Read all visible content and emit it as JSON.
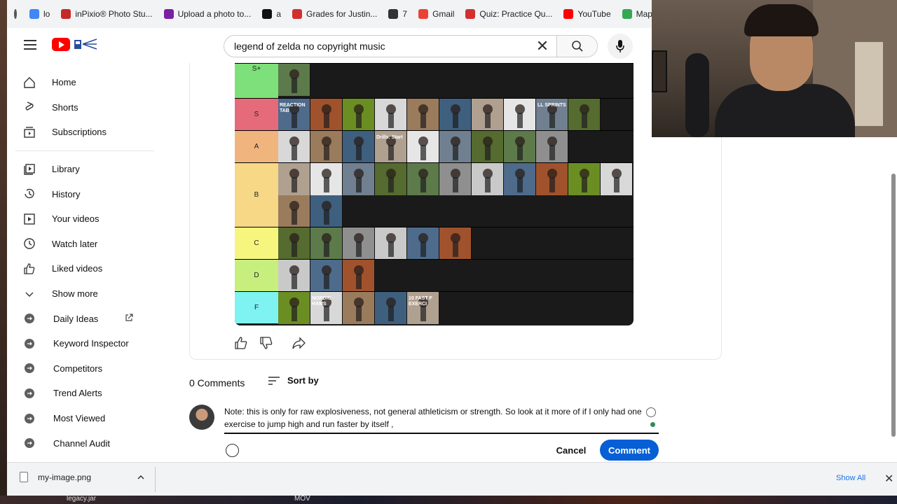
{
  "bookmarks": [
    {
      "label": "lo",
      "icon": "google-icon",
      "color": "#4285f4"
    },
    {
      "label": "inPixio® Photo Stu...",
      "icon": "bookmark-icon",
      "color": "#c62828"
    },
    {
      "label": "Upload a photo to...",
      "icon": "bookmark-icon",
      "color": "#7b1fa2"
    },
    {
      "label": "a",
      "icon": "gs-icon",
      "color": "#111111"
    },
    {
      "label": "Grades for Justin...",
      "icon": "canvas-icon",
      "color": "#d32f2f"
    },
    {
      "label": "7",
      "icon": "bookmark-icon",
      "color": "#333333"
    },
    {
      "label": "Gmail",
      "icon": "gmail-icon",
      "color": "#ea4335"
    },
    {
      "label": "Quiz: Practice Qu...",
      "icon": "canvas-icon",
      "color": "#d32f2f"
    },
    {
      "label": "YouTube",
      "icon": "youtube-icon",
      "color": "#ff0000"
    },
    {
      "label": "Maps",
      "icon": "maps-icon",
      "color": "#34a853"
    }
  ],
  "search": {
    "query": "legend of zelda no copyright music"
  },
  "sidebar": {
    "main": [
      {
        "label": "Home",
        "icon": "home-icon"
      },
      {
        "label": "Shorts",
        "icon": "shorts-icon"
      },
      {
        "label": "Subscriptions",
        "icon": "subscriptions-icon"
      }
    ],
    "library": [
      {
        "label": "Library",
        "icon": "library-icon"
      },
      {
        "label": "History",
        "icon": "history-icon"
      },
      {
        "label": "Your videos",
        "icon": "your-videos-icon"
      },
      {
        "label": "Watch later",
        "icon": "watch-later-icon"
      },
      {
        "label": "Liked videos",
        "icon": "liked-videos-icon"
      },
      {
        "label": "Show more",
        "icon": "chevron-down-icon"
      }
    ],
    "extension": [
      {
        "label": "Daily Ideas"
      },
      {
        "label": "Keyword Inspector"
      },
      {
        "label": "Competitors"
      },
      {
        "label": "Trend Alerts"
      },
      {
        "label": "Most Viewed"
      },
      {
        "label": "Channel Audit"
      }
    ]
  },
  "tierlist": {
    "rows": [
      {
        "label": "S+",
        "color": "#7ee07a",
        "count": 1
      },
      {
        "label": "S",
        "color": "#e56b7b",
        "count": 10
      },
      {
        "label": "A",
        "color": "#f0b57d",
        "count": 9
      },
      {
        "label": "B",
        "color": "#f6d886",
        "count": 13
      },
      {
        "label": "C",
        "color": "#f6f57e",
        "count": 6
      },
      {
        "label": "D",
        "color": "#c7ef7e",
        "count": 3
      },
      {
        "label": "F",
        "color": "#7ef3f1",
        "count": 5
      }
    ],
    "thumb_texts": [
      "REACTION TAB",
      "LL SPRINTS",
      "Drills: Start",
      "10 FAST F EXERCI",
      "NORDIC HAMS"
    ]
  },
  "comments": {
    "count_label": "0 Comments",
    "sort_label": "Sort by",
    "draft": "Note: this is only for raw explosiveness, not general athleticism or strength. So look at it more of if I only had one exercise to jump high and run faster by itself ,",
    "cancel_label": "Cancel",
    "submit_label": "Comment"
  },
  "downloads": {
    "file": "my-image.png",
    "show_all": "Show All"
  },
  "desktop": {
    "items": [
      "legacy.jar",
      "MOV"
    ]
  },
  "colors": {
    "accent": "#065fd4",
    "yt_red": "#ff0000"
  }
}
